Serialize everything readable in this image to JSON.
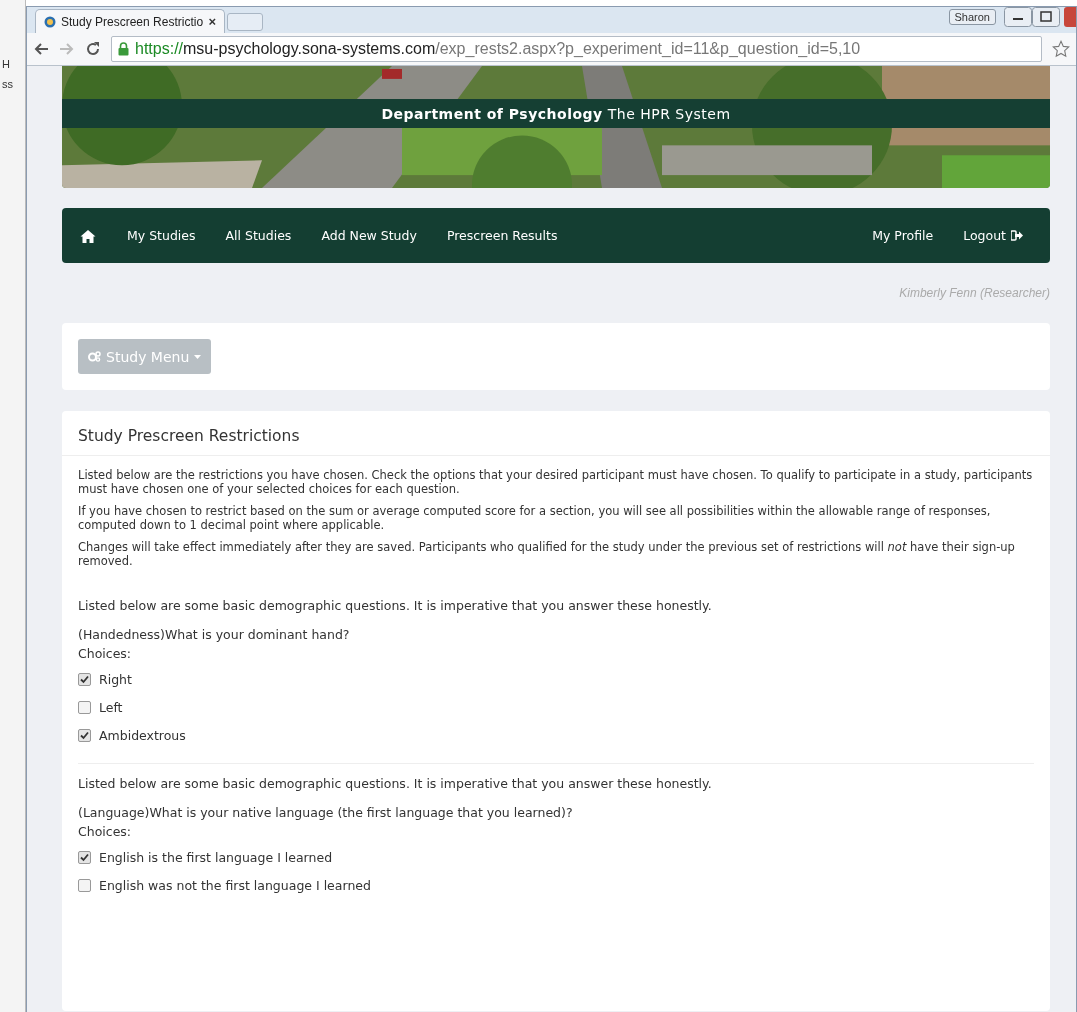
{
  "background_window": {
    "texts": [
      "H",
      "ss"
    ]
  },
  "browser": {
    "user_button": "Sharon",
    "tab": {
      "title": "Study Prescreen Restrictio",
      "close": "×"
    },
    "url": {
      "scheme": "https://",
      "host": "msu-psychology.sona-systems.com",
      "path": "/exp_rests2.aspx?p_experiment_id=11&p_question_id=5,10"
    }
  },
  "banner": {
    "title": "**Department of Psychology** The HPR System"
  },
  "nav": {
    "left": [
      "My Studies",
      "All Studies",
      "Add New Study",
      "Prescreen Results"
    ],
    "right": [
      "My Profile",
      "Logout"
    ]
  },
  "user": "Kimberly Fenn (Researcher)",
  "study_menu": "Study Menu",
  "panel": {
    "title": "Study Prescreen Restrictions",
    "paragraphs": [
      "Listed below are the restrictions you have chosen. Check the options that your desired participant must have chosen. To qualify to participate in a study, participants must have chosen one of your selected choices for each question.",
      "If you have chosen to restrict based on the sum or average computed score for a section, you will see all possibilities within the allowable range of responses, computed down to 1 decimal point where applicable.",
      "Changes will take effect immediately after they are saved. Participants who qualified for the study under the previous set of restrictions will *not* have their sign-up removed."
    ]
  },
  "questions": [
    {
      "intro": "Listed below are some basic demographic questions. It is imperative that you answer these honestly.",
      "question": "(Handedness)What is your dominant hand?",
      "choices_label": "Choices:",
      "choices": [
        {
          "label": "Right",
          "checked": true
        },
        {
          "label": "Left",
          "checked": false
        },
        {
          "label": "Ambidextrous",
          "checked": true
        }
      ]
    },
    {
      "intro": "Listed below are some basic demographic questions. It is imperative that you answer these honestly.",
      "question": "(Language)What is your native language (the first language that you learned)?",
      "choices_label": "Choices:",
      "choices": [
        {
          "label": "English is the first language I learned",
          "checked": true
        },
        {
          "label": "English was not the first language I learned",
          "checked": false
        }
      ]
    }
  ]
}
